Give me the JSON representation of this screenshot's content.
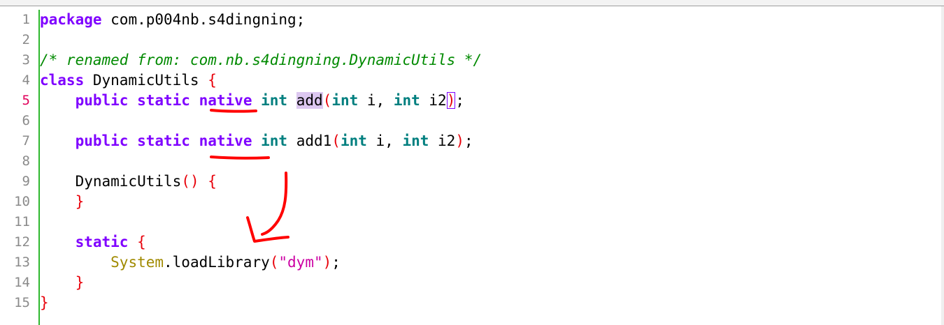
{
  "editor": {
    "line_numbers": [
      "1",
      "2",
      "3",
      "4",
      "5",
      "6",
      "7",
      "8",
      "9",
      "10",
      "11",
      "12",
      "13",
      "14",
      "15"
    ],
    "active_line": "5",
    "lines": {
      "l1": {
        "kw_package": "package",
        "pkg_name": " com.p004nb.s4dingning;"
      },
      "l3": {
        "comment": "/* renamed from: com.nb.s4dingning.DynamicUtils */"
      },
      "l4": {
        "kw_class": "class",
        "name": " DynamicUtils ",
        "brace": "{"
      },
      "l5": {
        "indent": "    ",
        "kw_public": "public",
        "kw_static": "static",
        "kw_native": "native",
        "t_int": "int",
        "method": "add",
        "paren_open": "(",
        "t_int_a": "int",
        "arg_i": " i, ",
        "t_int_b": "int",
        "arg_i2": " i2",
        "paren_close": ")",
        "semi": ";"
      },
      "l7": {
        "indent": "    ",
        "kw_public": "public",
        "kw_static": "static",
        "kw_native": "native",
        "t_int": "int",
        "method": " add1",
        "paren_open": "(",
        "t_int_a": "int",
        "arg_i": " i, ",
        "t_int_b": "int",
        "arg_i2": " i2",
        "paren_close": ")",
        "semi": ";"
      },
      "l9": {
        "indent": "    ",
        "ctor": "DynamicUtils",
        "parens": "()",
        "brace": "{"
      },
      "l10": {
        "indent": "    ",
        "brace": "}"
      },
      "l12": {
        "indent": "    ",
        "kw_static": "static",
        "brace": "{"
      },
      "l13": {
        "indent": "        ",
        "cls": "System",
        "call": ".loadLibrary",
        "paren_open": "(",
        "str": "\"dym\"",
        "paren_close": ")",
        "semi": ";"
      },
      "l14": {
        "indent": "    ",
        "brace": "}"
      },
      "l15": {
        "brace": "}"
      }
    }
  },
  "annotations": {
    "color": "#ff0000",
    "underline_targets": [
      "native",
      "native"
    ],
    "arrow": "curved-arrow-down-left"
  }
}
